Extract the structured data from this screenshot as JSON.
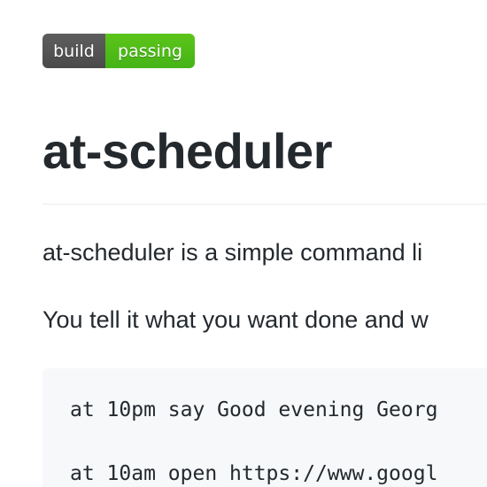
{
  "badge": {
    "left_label": "build",
    "right_label": "passing",
    "left_color": "#555555",
    "right_color": "#4cbb17"
  },
  "header": {
    "title": "at-scheduler"
  },
  "content": {
    "paragraphs": [
      "at-scheduler is a simple command li",
      "You tell it what you want done and w"
    ],
    "code_lines": [
      "at 10pm say Good evening Georg",
      "at 10am open https://www.googl"
    ]
  }
}
